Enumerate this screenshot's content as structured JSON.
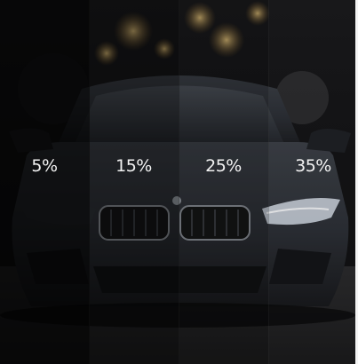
{
  "tint_levels": [
    {
      "label": "5%"
    },
    {
      "label": "15%"
    },
    {
      "label": "25%"
    },
    {
      "label": "35%"
    }
  ],
  "colors": {
    "car_body": "#2a2d33",
    "grille": "#151617",
    "headlight": "#cfd6e0",
    "bokeh": "#c9a25a",
    "label_text": "#f2f2f2"
  }
}
